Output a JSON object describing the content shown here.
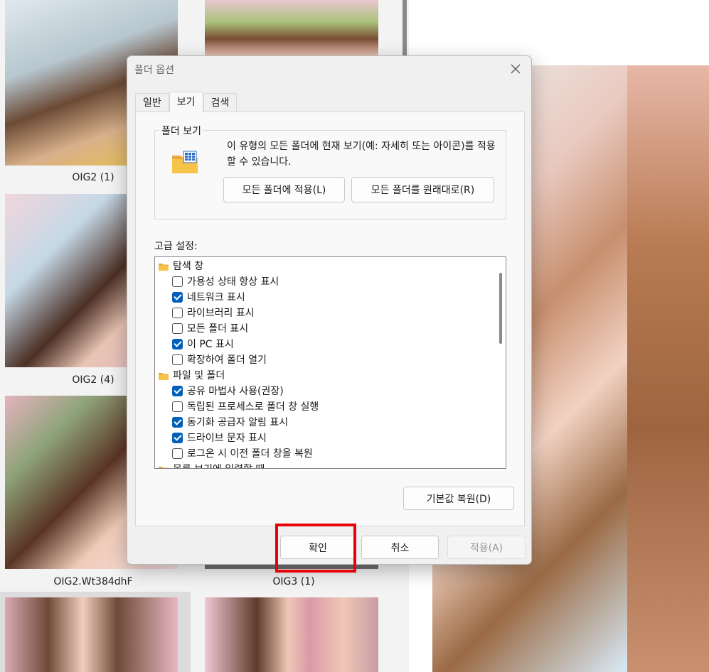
{
  "background": {
    "captions": [
      "OIG2 (1)",
      "OIG2 (4)",
      "OIG2.Wt384dhF",
      "OIG3 (1)"
    ]
  },
  "dialog": {
    "title": "폴더 옵션",
    "close_icon": "close-icon",
    "tabs": [
      {
        "label": "일반",
        "active": false
      },
      {
        "label": "보기",
        "active": true
      },
      {
        "label": "검색",
        "active": false
      }
    ],
    "folder_view": {
      "legend": "폴더 보기",
      "description": "이 유형의 모든 폴더에 현재 보기(예: 자세히 또는 아이콘)를 적용할 수 있습니다.",
      "apply_all_label": "모든 폴더에 적용(L)",
      "reset_all_label": "모든 폴더를 원래대로(R)"
    },
    "advanced_label": "고급 설정:",
    "tree": [
      {
        "type": "folder",
        "label": "탐색 창"
      },
      {
        "type": "check",
        "label": "가용성 상태 항상 표시",
        "checked": false
      },
      {
        "type": "check",
        "label": "네트워크 표시",
        "checked": true
      },
      {
        "type": "check",
        "label": "라이브러리 표시",
        "checked": false
      },
      {
        "type": "check",
        "label": "모든 폴더 표시",
        "checked": false
      },
      {
        "type": "check",
        "label": "이 PC 표시",
        "checked": true
      },
      {
        "type": "check",
        "label": "확장하여 폴더 열기",
        "checked": false
      },
      {
        "type": "folder",
        "label": "파일 및 폴더"
      },
      {
        "type": "check",
        "label": "공유 마법사 사용(권장)",
        "checked": true
      },
      {
        "type": "check",
        "label": "독립된 프로세스로 폴더 창 실행",
        "checked": false
      },
      {
        "type": "check",
        "label": "동기화 공급자 알림 표시",
        "checked": true
      },
      {
        "type": "check",
        "label": "드라이브 문자 표시",
        "checked": true
      },
      {
        "type": "check",
        "label": "로그온 시 이전 폴더 창을 복원",
        "checked": false
      },
      {
        "type": "folder",
        "label": "목록 보기에 입력할 때"
      }
    ],
    "restore_defaults_label": "기본값 복원(D)",
    "ok_label": "확인",
    "cancel_label": "취소",
    "apply_label": "적용(A)"
  }
}
